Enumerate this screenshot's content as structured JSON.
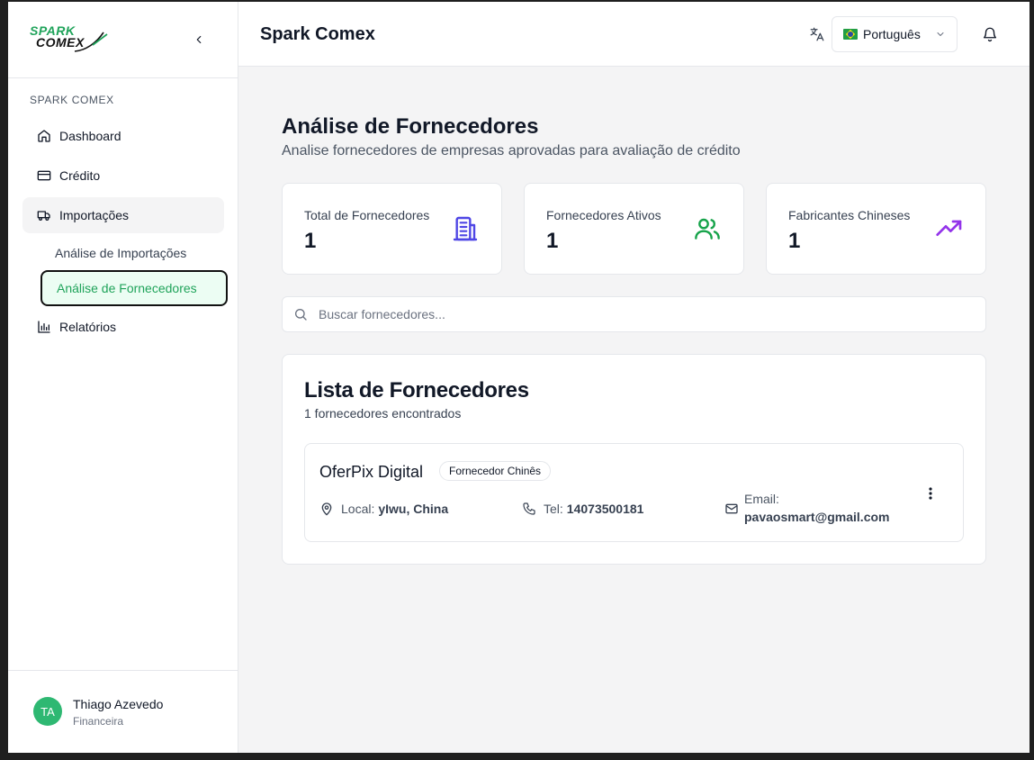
{
  "app": {
    "logo_line1": "SPARK",
    "logo_line2": "COMEX",
    "title": "Spark Comex"
  },
  "sidebar": {
    "section_label": "SPARK COMEX",
    "items": [
      {
        "label": "Dashboard",
        "icon": "home-icon"
      },
      {
        "label": "Crédito",
        "icon": "credit-card-icon"
      },
      {
        "label": "Importações",
        "icon": "truck-icon"
      },
      {
        "label": "Relatórios",
        "icon": "bar-chart-icon"
      }
    ],
    "sub_items": [
      {
        "label": "Análise de Importações"
      },
      {
        "label": "Análise de Fornecedores"
      }
    ],
    "user": {
      "initials": "TA",
      "name": "Thiago Azevedo",
      "role": "Financeira"
    }
  },
  "header": {
    "language": "Português",
    "language_flag": "brazil-flag"
  },
  "page": {
    "title": "Análise de Fornecedores",
    "subtitle": "Analise fornecedores de empresas aprovadas para avaliação de crédito"
  },
  "stats": [
    {
      "label": "Total de Fornecedores",
      "value": "1",
      "icon": "building-icon",
      "color": "#4f46e5"
    },
    {
      "label": "Fornecedores Ativos",
      "value": "1",
      "icon": "users-icon",
      "color": "#16a34a"
    },
    {
      "label": "Fabricantes Chineses",
      "value": "1",
      "icon": "trending-up-icon",
      "color": "#9333ea"
    }
  ],
  "search": {
    "placeholder": "Buscar fornecedores..."
  },
  "list": {
    "title": "Lista de Fornecedores",
    "count_text": "1 fornecedores encontrados",
    "suppliers": [
      {
        "name": "OferPix Digital",
        "badge": "Fornecedor Chinês",
        "location_label": "Local:",
        "location": "yIwu, China",
        "phone_label": "Tel:",
        "phone": "14073500181",
        "email_label": "Email:",
        "email": "pavaosmart@gmail.com"
      }
    ]
  },
  "colors": {
    "accent_green": "#1fa35a",
    "avatar": "#2eb872"
  }
}
